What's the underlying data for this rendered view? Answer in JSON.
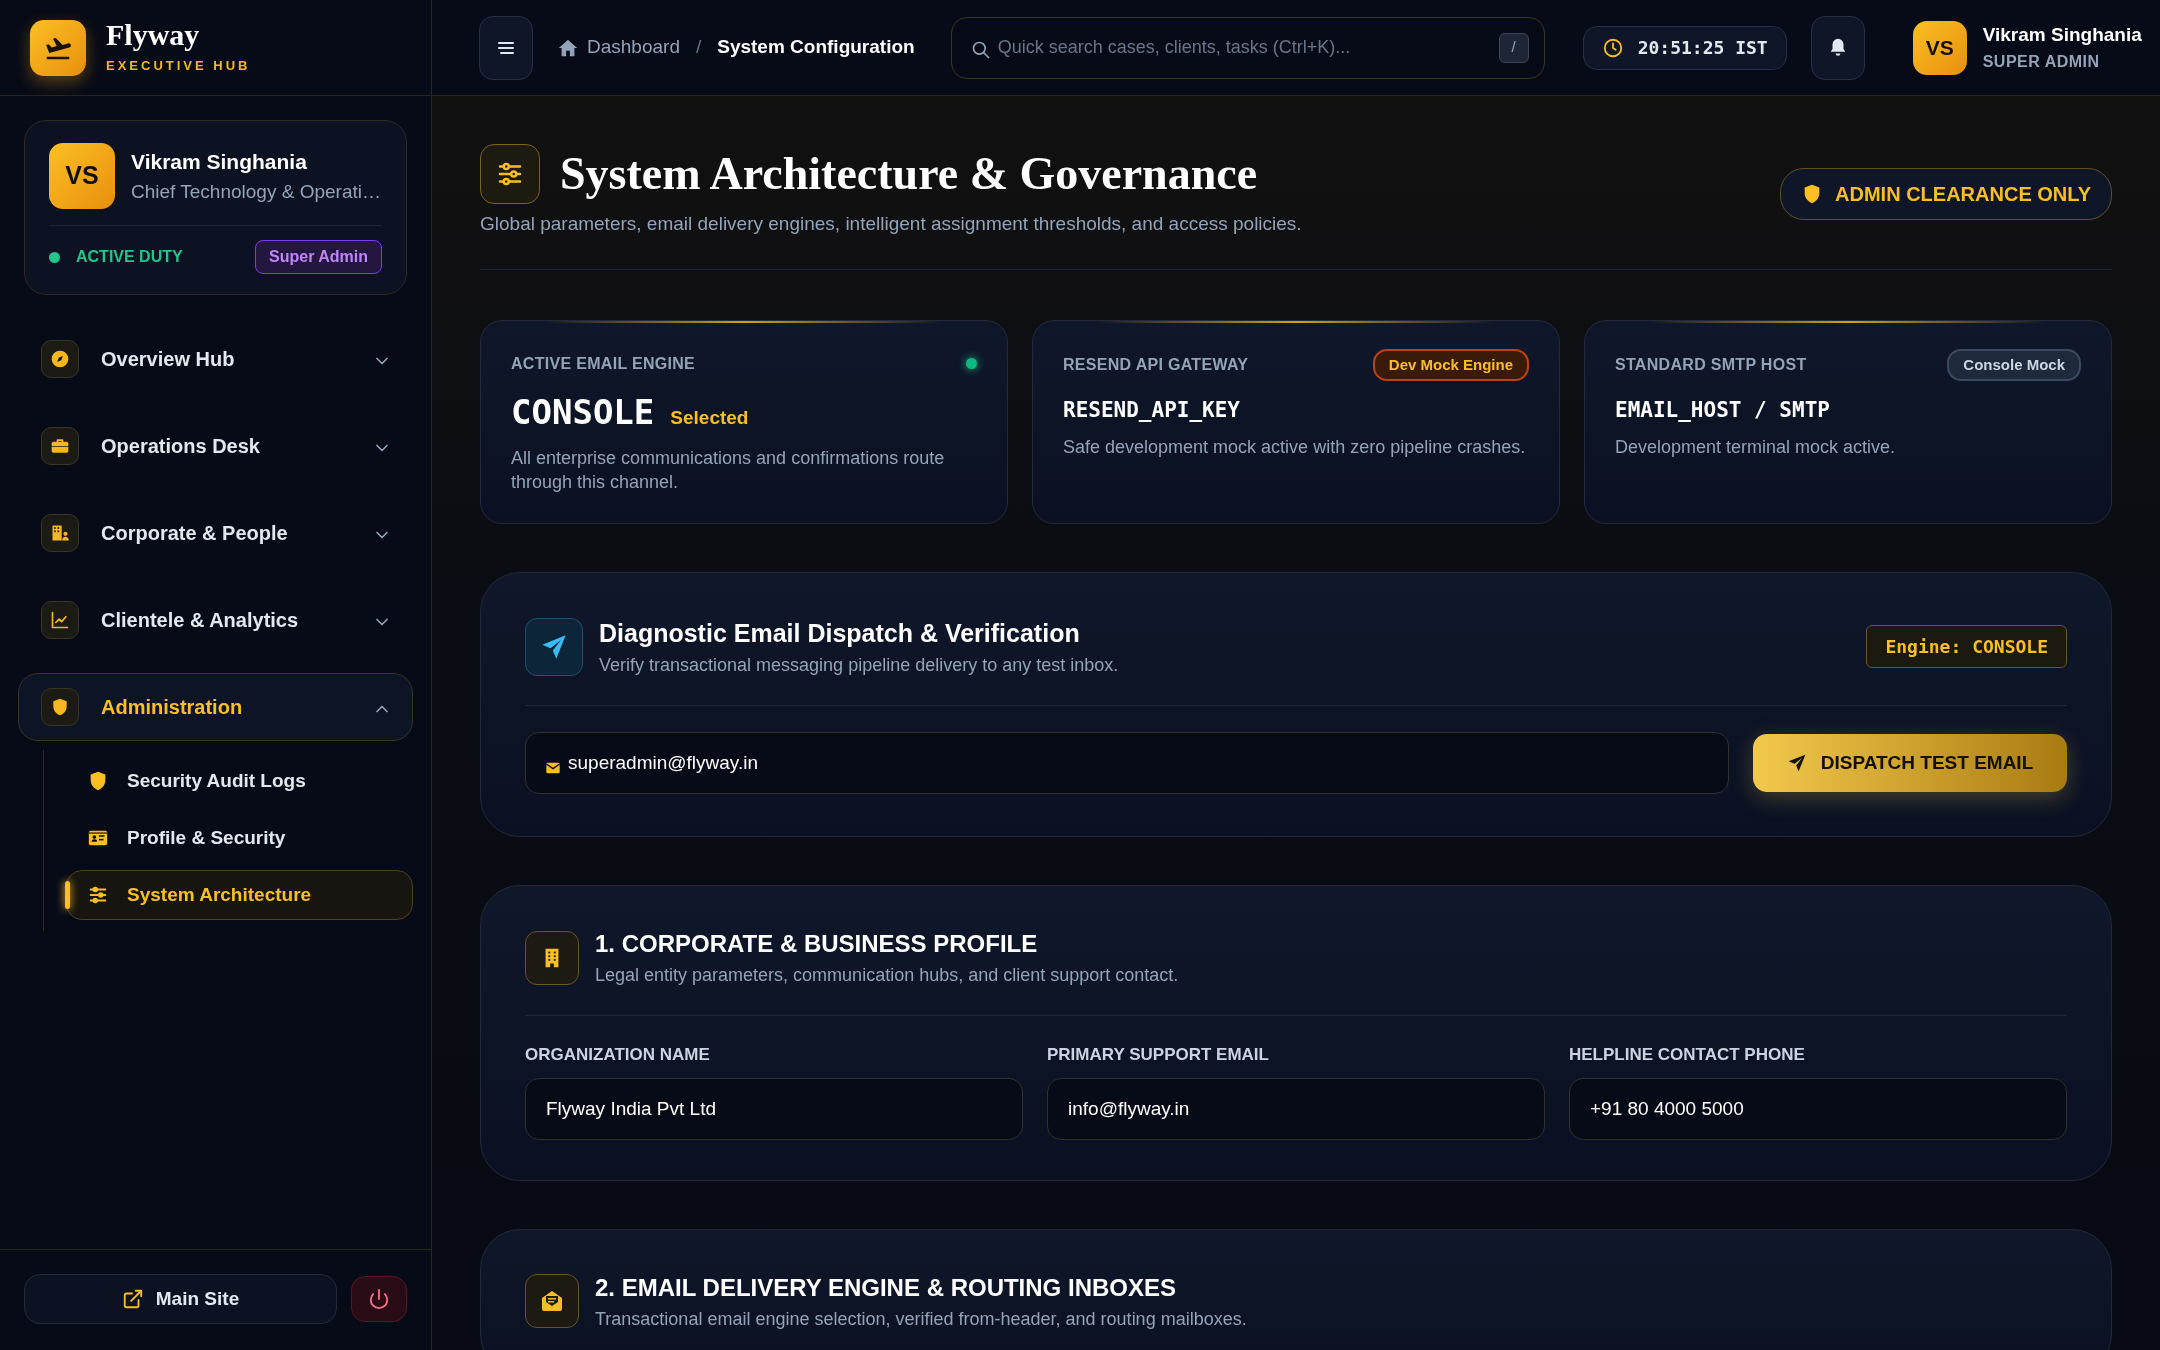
{
  "brand": {
    "name": "Flyway",
    "tagline": "EXECUTIVE HUB"
  },
  "profile": {
    "initials": "VS",
    "name": "Vikram Singhania",
    "role": "Chief Technology & Operati…",
    "status": "ACTIVE DUTY",
    "badge": "Super Admin"
  },
  "sidebar": {
    "items": [
      {
        "label": "Overview Hub",
        "expanded": false
      },
      {
        "label": "Operations Desk",
        "expanded": false
      },
      {
        "label": "Corporate & People",
        "expanded": false
      },
      {
        "label": "Clientele & Analytics",
        "expanded": false
      },
      {
        "label": "Administration",
        "expanded": true,
        "children": [
          {
            "label": "Security Audit Logs",
            "selected": false
          },
          {
            "label": "Profile & Security",
            "selected": false
          },
          {
            "label": "System Architecture",
            "selected": true
          }
        ]
      }
    ]
  },
  "sidebar_footer": {
    "main_site": "Main Site"
  },
  "topbar": {
    "breadcrumb": [
      "Dashboard",
      "System Configuration"
    ],
    "breadcrumb_separator": "/",
    "search": {
      "placeholder": "Quick search cases, clients, tasks (Ctrl+K)...",
      "shortcut": "/"
    },
    "clock": "20:51:25 IST",
    "user": {
      "initials": "VS",
      "name": "Vikram Singhania",
      "role": "SUPER ADMIN"
    }
  },
  "page": {
    "title": "System Architecture & Governance",
    "subtitle": "Global parameters, email delivery engines, intelligent assignment thresholds, and access policies.",
    "clearance": "ADMIN CLEARANCE ONLY"
  },
  "engine_cards": [
    {
      "kind": "active",
      "label": "ACTIVE EMAIL ENGINE",
      "value": "CONSOLE",
      "selected_text": "Selected",
      "note": "All enterprise communications and confirmations route through this channel."
    },
    {
      "kind": "option",
      "label": "RESEND API GATEWAY",
      "badge": "Dev Mock Engine",
      "color": "#c2410c",
      "value": "RESEND_API_KEY",
      "note": "Safe development mock active with zero pipeline crashes."
    },
    {
      "kind": "option",
      "label": "STANDARD SMTP HOST",
      "badge": "Console Mock",
      "color": "#3b4a60",
      "value": "EMAIL_HOST / SMTP",
      "note": "Development terminal mock active."
    }
  ],
  "diagnostic": {
    "title": "Diagnostic Email Dispatch & Verification",
    "subtitle": "Verify transactional messaging pipeline delivery to any test inbox.",
    "engine_tag": "Engine: CONSOLE",
    "email": "superadmin@flyway.in",
    "button": "DISPATCH TEST EMAIL"
  },
  "sections": [
    {
      "title": "1. CORPORATE & BUSINESS PROFILE",
      "subtitle": "Legal entity parameters, communication hubs, and client support contact.",
      "fields": [
        {
          "label": "ORGANIZATION NAME",
          "value": "Flyway India Pvt Ltd"
        },
        {
          "label": "PRIMARY SUPPORT EMAIL",
          "value": "info@flyway.in"
        },
        {
          "label": "HELPLINE CONTACT PHONE",
          "value": "+91 80 4000 5000"
        }
      ]
    },
    {
      "title": "2. EMAIL DELIVERY ENGINE & ROUTING INBOXES",
      "subtitle": "Transactional email engine selection, verified from-header, and routing mailboxes."
    }
  ]
}
